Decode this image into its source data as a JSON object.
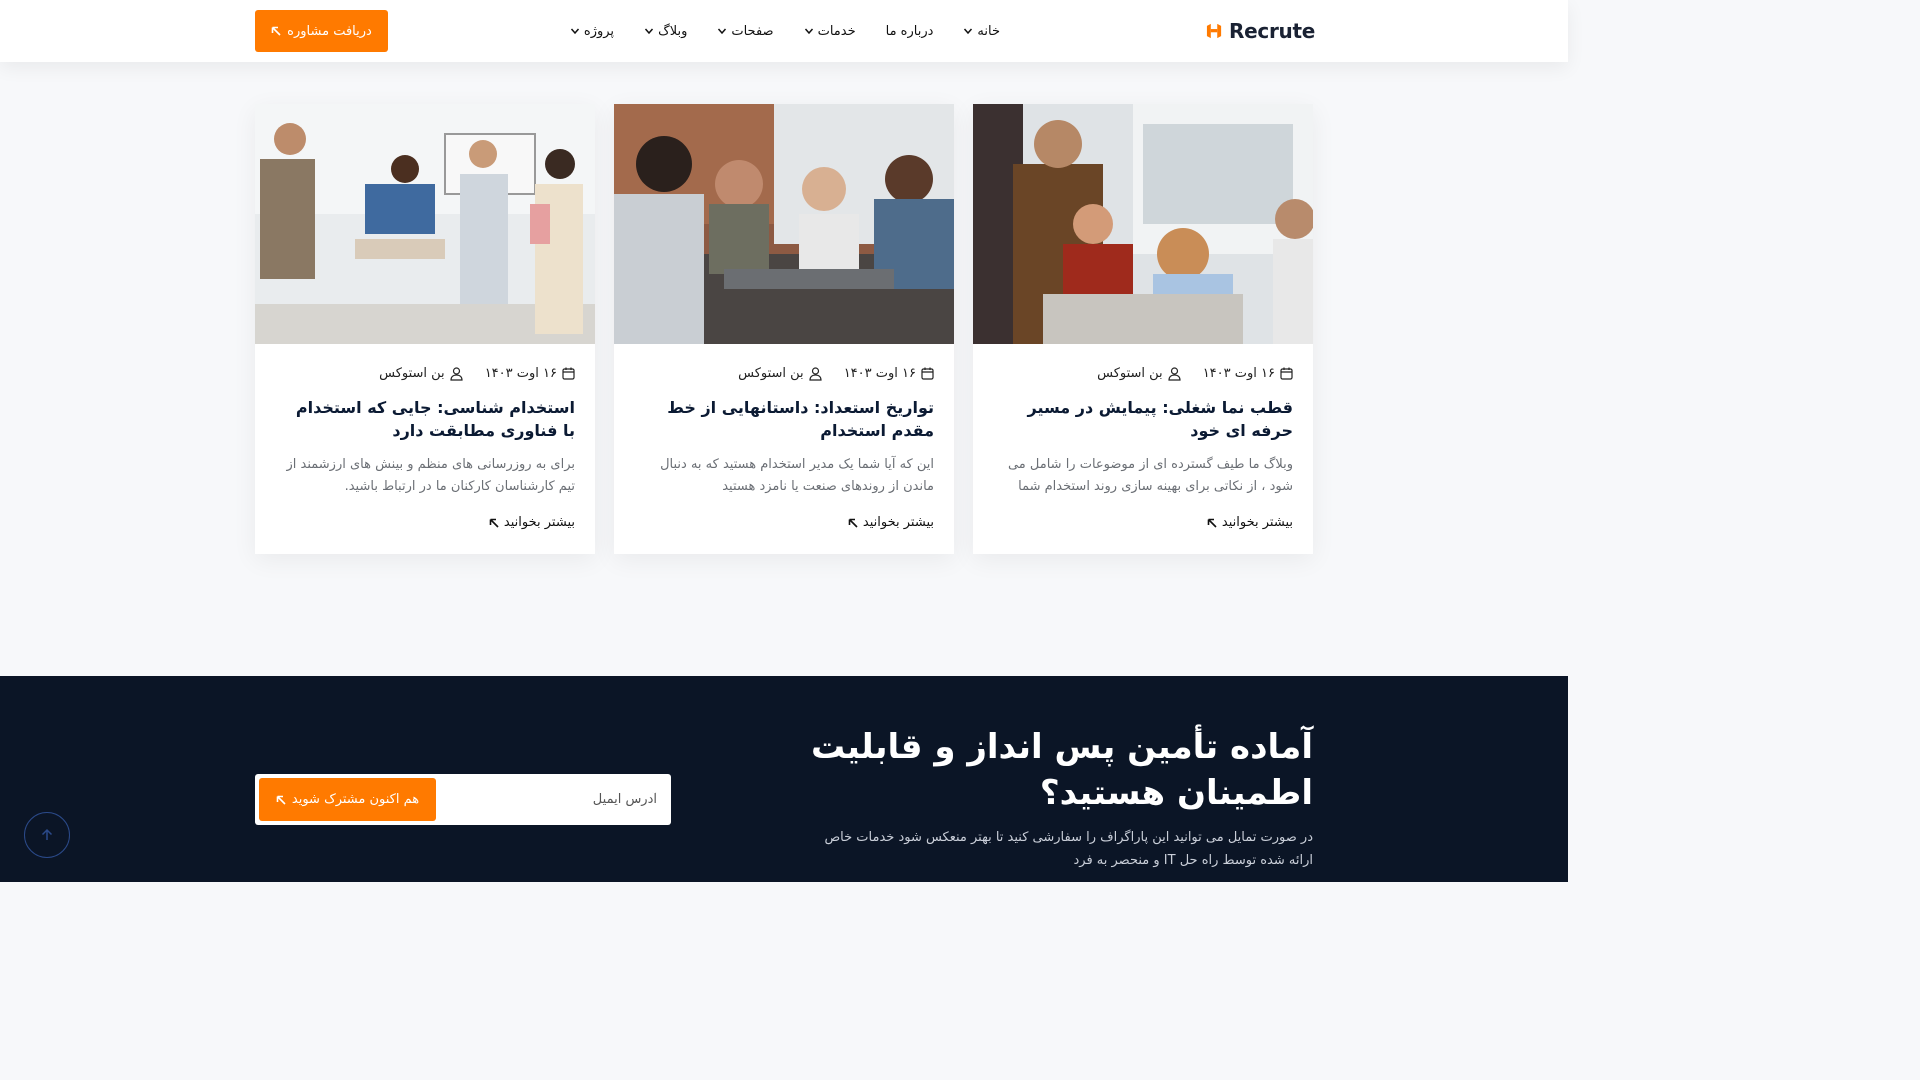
{
  "header": {
    "logo_text": "Recrute",
    "nav": [
      {
        "label": "خانه",
        "has_dropdown": true
      },
      {
        "label": "درباره ما",
        "has_dropdown": false
      },
      {
        "label": "خدمات",
        "has_dropdown": true
      },
      {
        "label": "صفحات",
        "has_dropdown": true
      },
      {
        "label": "وبلاگ",
        "has_dropdown": true
      },
      {
        "label": "پروژه",
        "has_dropdown": true
      }
    ],
    "cta_label": "دریافت مشاوره"
  },
  "posts": [
    {
      "date": "۱۶ اوت ۱۴۰۳",
      "author": "بن استوکس",
      "title": "قطب نما شغلی: پیمایش در مسیر حرفه ای خود",
      "excerpt": "وبلاگ ما طیف گسترده ای از موضوعات را شامل می شود ، از نکاتی برای بهینه سازی روند استخدام شما",
      "read_more": "بیشتر بخوانید"
    },
    {
      "date": "۱۶ اوت ۱۴۰۳",
      "author": "بن استوکس",
      "title": "تواریخ استعداد: داستانهایی از خط مقدم استخدام",
      "excerpt": "این که آیا شما یک مدیر استخدام هستید که به دنبال ماندن از روندهای صنعت یا نامزد هستید",
      "read_more": "بیشتر بخوانید"
    },
    {
      "date": "۱۶ اوت ۱۴۰۳",
      "author": "بن استوکس",
      "title": "استخدام شناسی: جایی که استخدام با فناوری مطابقت دارد",
      "excerpt": "برای به روزرسانی های منظم و بینش های ارزشمند از تیم کارشناسان کارکنان ما در ارتباط باشید.",
      "read_more": "بیشتر بخوانید"
    }
  ],
  "newsletter": {
    "title": "آماده تأمین پس انداز و قابلیت اطمینان هستید؟",
    "description": "در صورت تمایل می توانید این پاراگراف را سفارشی کنید تا بهتر منعکس شود خدمات خاص ارائه شده توسط راه حل IT و منحصر به فرد",
    "email_placeholder": "آدرس ایمیل",
    "button_label": "هم اکنون مشترک شوید"
  },
  "colors": {
    "accent": "#ff7a00",
    "dark": "#0b1526"
  }
}
